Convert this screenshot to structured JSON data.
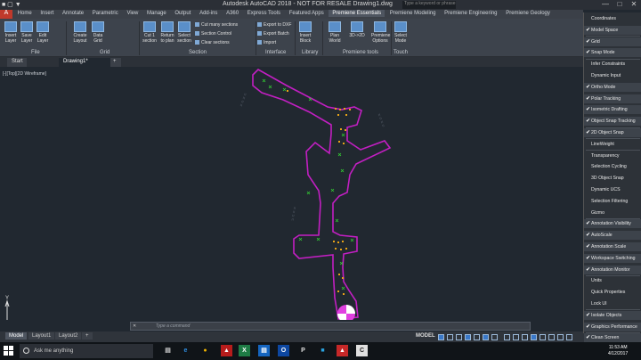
{
  "window": {
    "title": "Autodesk AutoCAD 2018 - NOT FOR RESALE    Drawing1.dwg",
    "search_placeholder": "Type a keyword or phrase",
    "minimize": "—",
    "maximize": "□",
    "close": "✕"
  },
  "ribbon_tabs": [
    "Home",
    "Insert",
    "Annotate",
    "Parametric",
    "View",
    "Manage",
    "Output",
    "Add-ins",
    "A360",
    "Express Tools",
    "Featured Apps",
    "Premiene Essentials",
    "Premiene Modeling",
    "Premiene Engineering",
    "Premiene Geology"
  ],
  "ribbon": {
    "file_buttons": [
      "Insert Layer",
      "Save Layer",
      "Edit Layer"
    ],
    "grid_buttons": [
      "Create Layout",
      "Data Grid"
    ],
    "section_buttons": [
      "Cut 1 section",
      "Return to plan",
      "Select section"
    ],
    "section_small": [
      "Cut many sections",
      "Section Control",
      "Clear sections"
    ],
    "interface_small": [
      "Export to DXF",
      "Export Batch",
      "Import"
    ],
    "library_buttons": [
      "Insert Block"
    ],
    "premiene_buttons": [
      "Plan World",
      "3D->2D",
      "Premiene Options"
    ],
    "touch_buttons": [
      "Select Mode"
    ],
    "panels": [
      "File",
      "Grid",
      "Section",
      "Interface",
      "Library",
      "Premiene tools",
      "Touch"
    ]
  },
  "document_tabs": [
    "Start",
    "Drawing1*"
  ],
  "add_tab": "+",
  "viewport_label": "[-][Top][2D Wireframe]",
  "command_line": {
    "close": "✕",
    "placeholder": "Type a command"
  },
  "layout_tabs": [
    "Model",
    "Layout1",
    "Layout2"
  ],
  "add_layout": "+",
  "status_model": "MODEL",
  "taskbar": {
    "search": "Ask me anything",
    "apps": [
      "▤",
      "e",
      "●",
      "▲",
      "X",
      "▤",
      "O",
      "P",
      "■",
      "▲",
      "C"
    ],
    "time": "11:53 AM",
    "date": "4/12/2017"
  },
  "colors": {
    "accent": "#3a78c8",
    "boundary": "#c21fc2",
    "markers_green": "#33cc33",
    "markers_orange": "#e8a317"
  },
  "customization_menu": [
    {
      "label": "Coordinates",
      "checked": false
    },
    {
      "label": "Model Space",
      "checked": true
    },
    {
      "label": "Grid",
      "checked": true
    },
    {
      "label": "Snap Mode",
      "checked": true
    },
    {
      "label": "Infer Constraints",
      "checked": false
    },
    {
      "label": "Dynamic Input",
      "checked": false
    },
    {
      "label": "Ortho Mode",
      "checked": true
    },
    {
      "label": "Polar Tracking",
      "checked": true
    },
    {
      "label": "Isometric Drafting",
      "checked": true
    },
    {
      "label": "Object Snap Tracking",
      "checked": true
    },
    {
      "label": "2D Object Snap",
      "checked": true
    },
    {
      "label": "LineWeight",
      "checked": false
    },
    {
      "label": "Transparency",
      "checked": false
    },
    {
      "label": "Selection Cycling",
      "checked": false
    },
    {
      "label": "3D Object Snap",
      "checked": false
    },
    {
      "label": "Dynamic UCS",
      "checked": false
    },
    {
      "label": "Selection Filtering",
      "checked": false
    },
    {
      "label": "Gizmo",
      "checked": false
    },
    {
      "label": "Annotation Visibility",
      "checked": true
    },
    {
      "label": "AutoScale",
      "checked": true
    },
    {
      "label": "Annotation Scale",
      "checked": true
    },
    {
      "label": "Workspace Switching",
      "checked": true
    },
    {
      "label": "Annotation Monitor",
      "checked": true
    },
    {
      "label": "Units",
      "checked": false
    },
    {
      "label": "Quick Properties",
      "checked": false
    },
    {
      "label": "Lock UI",
      "checked": false
    },
    {
      "label": "Isolate Objects",
      "checked": true
    },
    {
      "label": "Graphics Performance",
      "checked": true
    },
    {
      "label": "Clean Screen",
      "checked": true
    }
  ]
}
